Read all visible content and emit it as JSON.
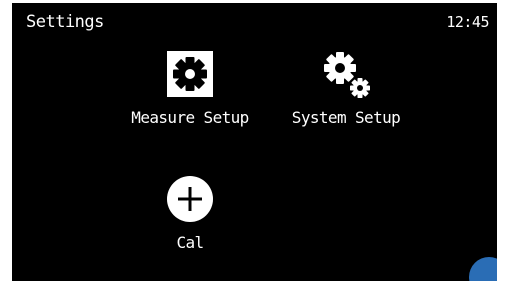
{
  "header": {
    "title": "Settings",
    "time": "12:45"
  },
  "menu": {
    "items": [
      {
        "label": "Measure Setup",
        "icon": "gear-icon"
      },
      {
        "label": "System Setup",
        "icon": "gears-icon"
      },
      {
        "label": "Cal",
        "icon": "plus-circle-icon"
      }
    ]
  },
  "colors": {
    "background": "#000000",
    "foreground": "#ffffff",
    "accent": "#2a6db5"
  }
}
